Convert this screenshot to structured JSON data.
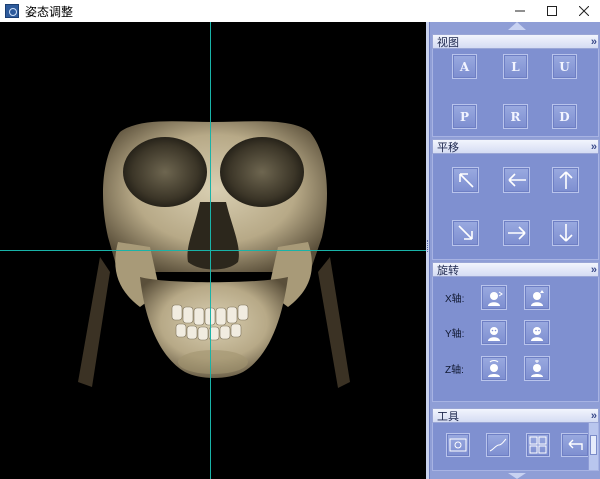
{
  "window": {
    "title": "姿态调整"
  },
  "panel": {
    "sections": {
      "view": {
        "title": "视图",
        "buttons": [
          "A",
          "L",
          "U",
          "P",
          "R",
          "D"
        ]
      },
      "pan": {
        "title": "平移",
        "buttons": [
          "arrow-up-left-icon",
          "arrow-left-icon",
          "arrow-up-icon",
          "arrow-down-right-icon",
          "arrow-right-icon",
          "arrow-down-icon"
        ]
      },
      "rotate": {
        "title": "旋转",
        "x_label": "X轴:",
        "y_label": "Y轴:",
        "z_label": "Z轴:"
      },
      "tools": {
        "title": "工具"
      }
    }
  },
  "colors": {
    "panel_bg": "#8f9ed6",
    "button_bg": "#8797d8",
    "crosshair": "#19b3a8",
    "viewport_bg": "#000000"
  }
}
